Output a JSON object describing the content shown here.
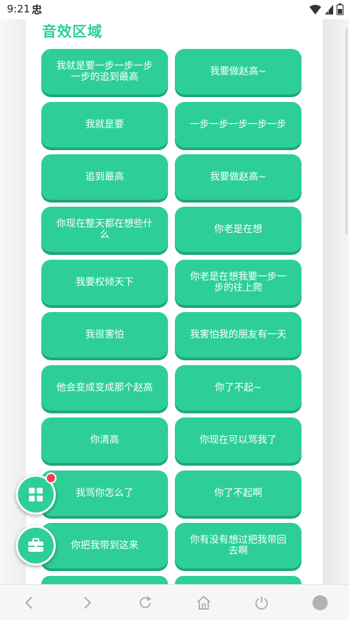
{
  "status_bar": {
    "time": "9:21",
    "notif_glyph": "忠",
    "icons": [
      "wifi-icon",
      "signal-icon",
      "battery-icon"
    ]
  },
  "section": {
    "title": "音效区域"
  },
  "sound_buttons": [
    {
      "label": "我就是要一步一步一步一步的追到最高"
    },
    {
      "label": "我要做赵高~"
    },
    {
      "label": "我就是要"
    },
    {
      "label": "一步一步一步一步一步"
    },
    {
      "label": "追到最高"
    },
    {
      "label": "我要做赵高~"
    },
    {
      "label": "你现在整天都在想些什么"
    },
    {
      "label": "你老是在想"
    },
    {
      "label": "我要权倾天下"
    },
    {
      "label": "你老是在想我要一步一步的往上爬"
    },
    {
      "label": "我很害怕"
    },
    {
      "label": "我害怕我的朋友有一天"
    },
    {
      "label": "他会变成变成那个赵高"
    },
    {
      "label": "你了不起~"
    },
    {
      "label": "你清高"
    },
    {
      "label": "你现在可以骂我了"
    },
    {
      "label": "我骂你怎么了"
    },
    {
      "label": "你了不起啊"
    },
    {
      "label": "你把我带到这来"
    },
    {
      "label": "你有没有想过把我带回去啊"
    }
  ],
  "floating_buttons": {
    "grid_icon": "grid-icon",
    "toolbox_icon": "toolbox-icon"
  },
  "bottom_nav": {
    "icons": [
      "back-icon",
      "forward-icon",
      "refresh-icon",
      "home-icon",
      "power-icon",
      "circle-icon"
    ]
  },
  "colors": {
    "accent": "#2ecf96",
    "accent_shadow": "#1fa877",
    "title": "#2ccf9a",
    "badge": "#f04050"
  }
}
